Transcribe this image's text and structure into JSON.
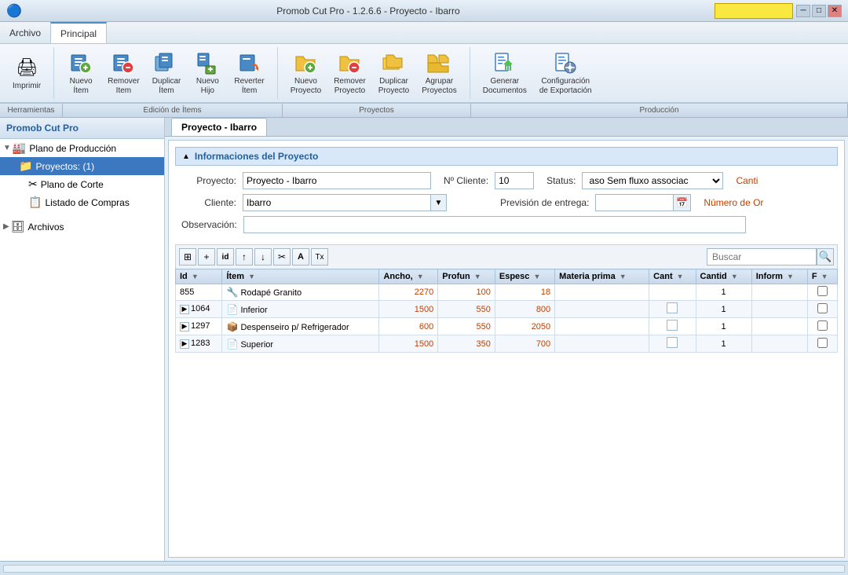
{
  "titleBar": {
    "title": "Promob Cut Pro - 1.2.6.6 - Proyecto - Ibarro",
    "minBtn": "─",
    "maxBtn": "□",
    "closeBtn": "✕"
  },
  "menuBar": {
    "items": [
      {
        "id": "archivo",
        "label": "Archivo",
        "active": false
      },
      {
        "id": "principal",
        "label": "Principal",
        "active": true
      }
    ]
  },
  "toolbar": {
    "sections": [
      {
        "id": "imprimir",
        "buttons": [
          {
            "id": "imprimir",
            "label": "Imprimir",
            "icon": "🖨"
          }
        ]
      },
      {
        "id": "edicion",
        "label": "Edición de Ítems",
        "buttons": [
          {
            "id": "nuevo-item",
            "label": "Nuevo\nÍtem",
            "icon": "📦"
          },
          {
            "id": "remover-item",
            "label": "Remover\nÍtem",
            "icon": "🗑"
          },
          {
            "id": "duplicar-item",
            "label": "Duplicar\nÍtem",
            "icon": "📋"
          },
          {
            "id": "nuevo-hijo",
            "label": "Nuevo\nHijo",
            "icon": "📦"
          },
          {
            "id": "reverter-item",
            "label": "Reverter\nÍtem",
            "icon": "↩"
          }
        ]
      },
      {
        "id": "proyectos",
        "label": "Proyectos",
        "buttons": [
          {
            "id": "nuevo-proyecto",
            "label": "Nuevo\nProyecto",
            "icon": "📁"
          },
          {
            "id": "remover-proyecto",
            "label": "Remover\nProyecto",
            "icon": "🗑"
          },
          {
            "id": "duplicar-proyecto",
            "label": "Duplicar\nProyecto",
            "icon": "📋"
          },
          {
            "id": "agrupar-proyectos",
            "label": "Agrupar\nProyectos",
            "icon": "🗂"
          }
        ]
      },
      {
        "id": "produccion",
        "label": "Producción",
        "buttons": [
          {
            "id": "generar-documentos",
            "label": "Generar\nDocumentos",
            "icon": "📄"
          },
          {
            "id": "configuracion-exportacion",
            "label": "Configuración\nde Exportación",
            "icon": "⚙"
          }
        ]
      }
    ]
  },
  "sidebar": {
    "title": "Promob Cut Pro",
    "tree": [
      {
        "id": "plano-produccion",
        "label": "Plano de Producción",
        "level": 0,
        "icon": "🏭",
        "expanded": true,
        "hasArrow": true
      },
      {
        "id": "proyectos",
        "label": "Proyectos: (1)",
        "level": 1,
        "icon": "📁",
        "selected": true
      },
      {
        "id": "plano-corte",
        "label": "Plano de Corte",
        "level": 2,
        "icon": "✂",
        "selected": false
      },
      {
        "id": "listado-compras",
        "label": "Listado de Compras",
        "level": 2,
        "icon": "📋",
        "selected": false
      },
      {
        "id": "archivos",
        "label": "Archivos",
        "level": 0,
        "icon": "🗄",
        "expanded": false,
        "hasArrow": true
      }
    ]
  },
  "content": {
    "tab": "Proyecto - Ibarro",
    "sectionTitle": "Informaciones del Proyecto",
    "form": {
      "proyectoLabel": "Proyecto:",
      "proyectoValue": "Proyecto - Ibarro",
      "nroClienteLabel": "Nº Cliente:",
      "nroClienteValue": "10",
      "statusLabel": "Status:",
      "statusValue": "aso Sem fluxo associac",
      "cantiLabel": "Canti",
      "clienteLabel": "Cliente:",
      "clienteValue": "Ibarro",
      "previsionLabel": "Previsión de entrega:",
      "nroOrLabel": "Número de Or",
      "observacionLabel": "Observación:"
    },
    "tableToolbar": {
      "searchPlaceholder": "Buscar",
      "buttons": [
        "⊞",
        "+",
        "id",
        "↑",
        "↓",
        "✂",
        "A",
        "Tx"
      ]
    },
    "table": {
      "columns": [
        {
          "id": "id",
          "label": "Id"
        },
        {
          "id": "item",
          "label": "Ítem"
        },
        {
          "id": "ancho",
          "label": "Ancho,"
        },
        {
          "id": "profun",
          "label": "Profun"
        },
        {
          "id": "espesc",
          "label": "Espesc"
        },
        {
          "id": "materia",
          "label": "Materia prima"
        },
        {
          "id": "cant1",
          "label": "Cant"
        },
        {
          "id": "cantid",
          "label": "Cantid"
        },
        {
          "id": "inform",
          "label": "Inform"
        },
        {
          "id": "f",
          "label": "F"
        }
      ],
      "rows": [
        {
          "id": "855",
          "item": "Rodapé Granito",
          "ancho": "2270",
          "profun": "100",
          "espesc": "18",
          "materia": "",
          "cant1": "",
          "cantid": "1",
          "inform": "",
          "f": false,
          "expandable": false,
          "icon": "🔧"
        },
        {
          "id": "1064",
          "item": "Inferior",
          "ancho": "1500",
          "profun": "550",
          "espesc": "800",
          "materia": "",
          "cant1": "",
          "cantid": "1",
          "inform": "",
          "f": false,
          "expandable": true,
          "icon": "📄"
        },
        {
          "id": "1297",
          "item": "Despenseiro p/ Refrigerador",
          "ancho": "600",
          "profun": "550",
          "espesc": "2050",
          "materia": "",
          "cant1": "",
          "cantid": "1",
          "inform": "",
          "f": false,
          "expandable": true,
          "icon": "📦"
        },
        {
          "id": "1283",
          "item": "Superior",
          "ancho": "1500",
          "profun": "350",
          "espesc": "700",
          "materia": "",
          "cant1": "",
          "cantid": "1",
          "inform": "",
          "f": false,
          "expandable": true,
          "icon": "📄"
        }
      ]
    }
  }
}
